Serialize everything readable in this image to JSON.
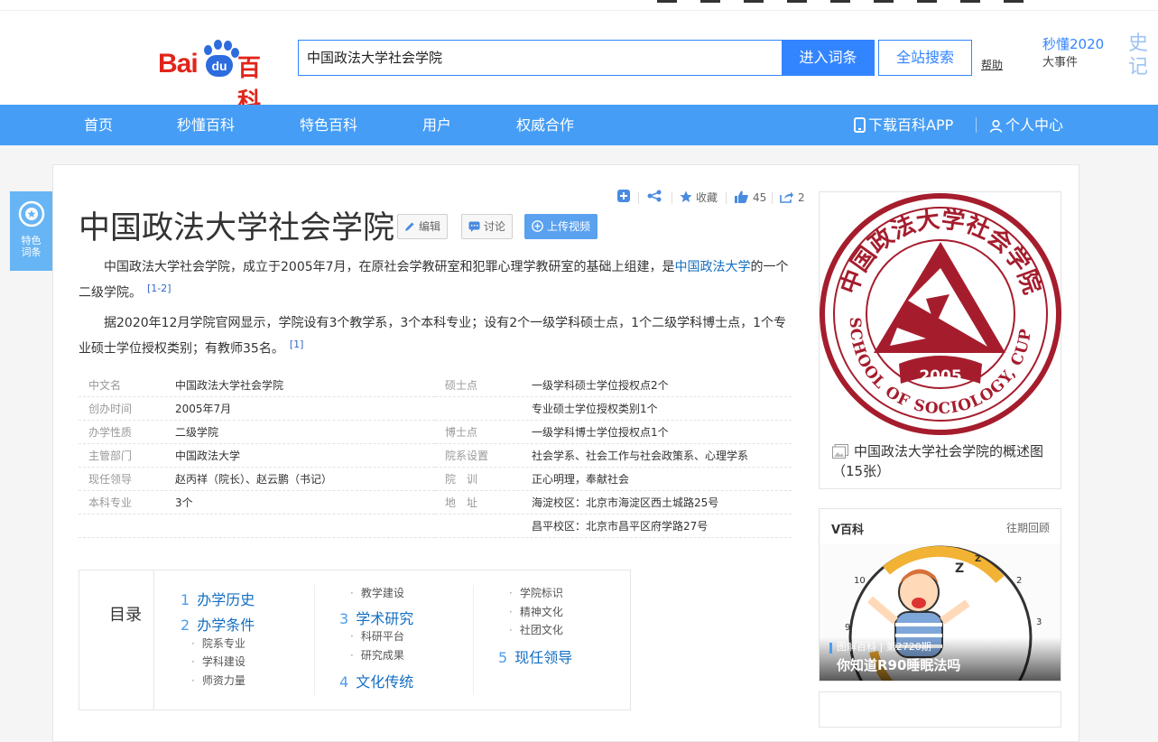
{
  "header": {
    "logo_bai": "Bai",
    "logo_du": "du",
    "logo_baike": "百科",
    "search_value": "中国政法大学社会学院",
    "enter_button": "进入词条",
    "site_search_button": "全站搜索",
    "help_link": "帮助",
    "miaodong_link": "秒懂2020",
    "dashijian_link": "大事件",
    "shiji_link": "史记"
  },
  "nav": {
    "items": [
      "首页",
      "秒懂百科",
      "特色百科",
      "用户",
      "权威合作"
    ],
    "download_app": "下载百科APP",
    "personal_center": "个人中心"
  },
  "side_badge": {
    "line1": "特色",
    "line2": "词条"
  },
  "toolbar": {
    "collect": "收藏",
    "like_count": "45",
    "share_count": "2"
  },
  "entry": {
    "title": "中国政法大学社会学院",
    "edit_button": "编辑",
    "discuss_button": "讨论",
    "upload_video_button": "上传视频",
    "para1_a": "中国政法大学社会学院，成立于2005年7月，在原社会学教研室和犯罪心理学教研室的基础上组建，是",
    "para1_link": "中国政法大学",
    "para1_b": "的一个二级学院。",
    "para1_ref": "[1-2]",
    "para2": "据2020年12月学院官网显示，学院设有3个教学系，3个本科专业；设有2个一级学科硕士点，1个二级学科博士点，1个专业硕士学位授权类别；有教师35名。",
    "para2_ref": "[1]"
  },
  "basic_info": {
    "left": [
      {
        "label": "中文名",
        "value": "中国政法大学社会学院"
      },
      {
        "label": "创办时间",
        "value": "2005年7月"
      },
      {
        "label": "办学性质",
        "value": "二级学院"
      },
      {
        "label": "主管部门",
        "value": "中国政法大学"
      },
      {
        "label": "现任领导",
        "value": "赵丙祥（院长）、赵云鹏（书记）"
      },
      {
        "label": "本科专业",
        "value": "3个"
      }
    ],
    "right": [
      {
        "label": "硕士点",
        "value": "一级学科硕士学位授权点2个"
      },
      {
        "label": "",
        "value": "专业硕士学位授权类别1个"
      },
      {
        "label": "博士点",
        "value": "一级学科博士学位授权点1个"
      },
      {
        "label": "院系设置",
        "value": "社会学系、社会工作与社会政策系、心理学系"
      },
      {
        "label": "院　训",
        "value": "正心明理，奉献社会"
      },
      {
        "label": "地　址",
        "value": "海淀校区：北京市海淀区西土城路25号"
      },
      {
        "label": "",
        "value": "昌平校区：北京市昌平区府学路27号"
      }
    ]
  },
  "catalog": {
    "title": "目录",
    "col1": [
      {
        "num": "1",
        "label": "办学历史"
      },
      {
        "num": "2",
        "label": "办学条件"
      }
    ],
    "col1_sub": [
      "院系专业",
      "学科建设",
      "师资力量"
    ],
    "col2_pre": [
      "教学建设"
    ],
    "col2": [
      {
        "num": "3",
        "label": "学术研究"
      }
    ],
    "col2_sub": [
      "科研平台",
      "研究成果"
    ],
    "col2_b": [
      {
        "num": "4",
        "label": "文化传统"
      }
    ],
    "col3_sub": [
      "学院标识",
      "精神文化",
      "社团文化"
    ],
    "col3": [
      {
        "num": "5",
        "label": "现任领导"
      }
    ]
  },
  "album": {
    "seal_text_top": "中国政法大学社会学院",
    "seal_text_bottom": "SCHOOL OF SOCIOLOGY, CUPL",
    "seal_year": "2005",
    "caption": "中国政法大学社会学院的概述图（15张）"
  },
  "vbaike": {
    "title": "V百科",
    "history_link": "往期回顾",
    "issue": "图解百科 | 第2720期",
    "video_title": "你知道R90睡眠法吗"
  },
  "colors": {
    "accent": "#3385ff",
    "nav": "#459df5",
    "brand_red": "#e1251b",
    "seal_red": "#a51d2d"
  }
}
